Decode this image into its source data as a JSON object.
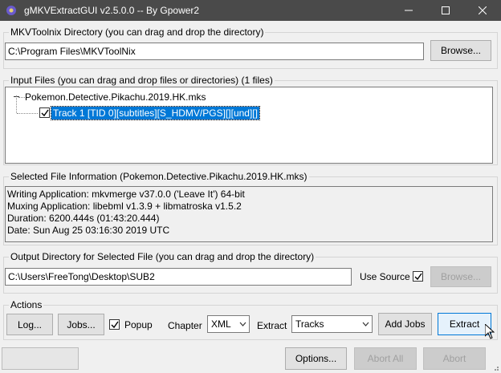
{
  "window": {
    "title": "gMKVExtractGUI v2.5.0.0 -- By Gpower2"
  },
  "mkvtoolnix": {
    "label": "MKVToolnix Directory (you can drag and drop the directory)",
    "path": "C:\\Program Files\\MKVToolNix",
    "browse_label": "Browse..."
  },
  "input_files": {
    "label": "Input Files (you can drag and drop files or directories) (1 files)",
    "file_name": "Pokemon.Detective.Pikachu.2019.HK.mks",
    "track_label": "Track 1 [TID 0][subtitles][S_HDMV/PGS][][und][]"
  },
  "file_info": {
    "label": "Selected File Information (Pokemon.Detective.Pikachu.2019.HK.mks)",
    "lines": [
      "Writing Application: mkvmerge v37.0.0 ('Leave It') 64-bit",
      "Muxing Application: libebml v1.3.9 + libmatroska v1.5.2",
      "Duration: 6200.444s (01:43:20.444)",
      "Date: Sun Aug 25 03:16:30 2019 UTC"
    ]
  },
  "output": {
    "label": "Output Directory for Selected File (you can drag and drop the directory)",
    "path": "C:\\Users\\FreeTong\\Desktop\\SUB2",
    "use_source_label": "Use Source",
    "browse_label": "Browse..."
  },
  "actions": {
    "label": "Actions",
    "log_label": "Log...",
    "jobs_label": "Jobs...",
    "popup_label": "Popup",
    "chapter_label": "Chapter",
    "chapter_value": "XML",
    "extract_label": "Extract",
    "extract_value": "Tracks",
    "add_jobs_label": "Add Jobs",
    "extract_button_label": "Extract"
  },
  "bottom": {
    "options_label": "Options...",
    "abort_all_label": "Abort All",
    "abort_label": "Abort"
  },
  "colors": {
    "titlebar": "#4a4a4a",
    "selection": "#0078d7"
  }
}
